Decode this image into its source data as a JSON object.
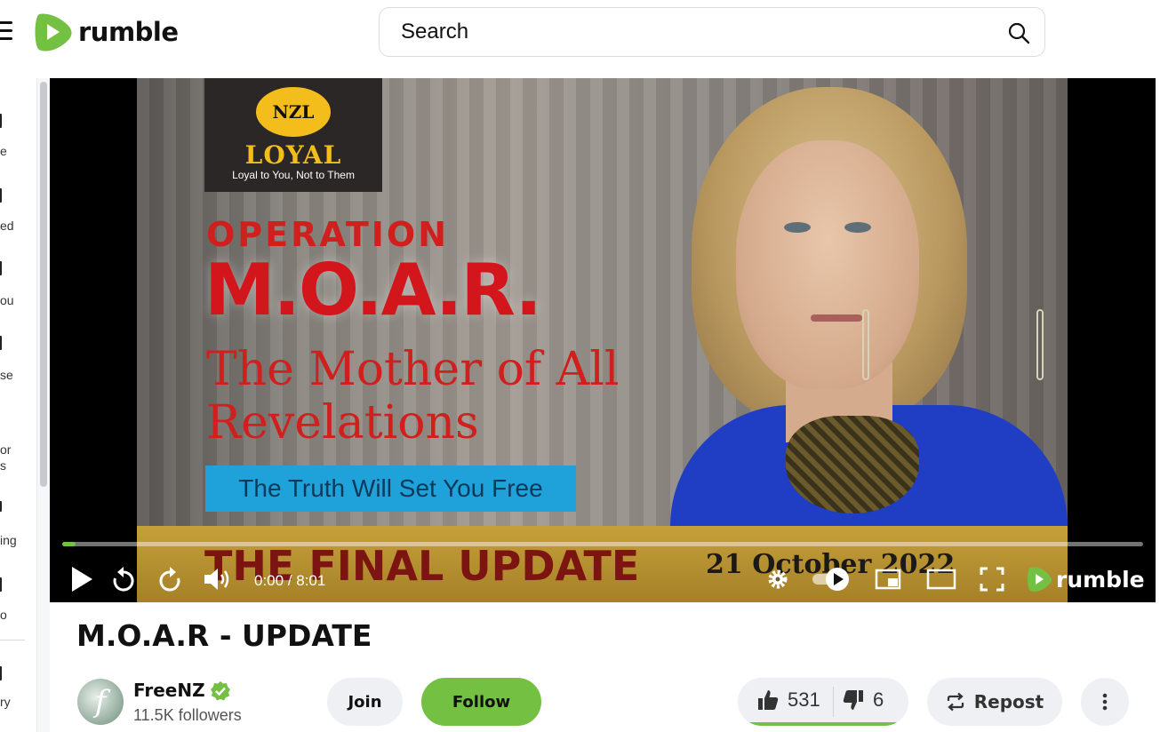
{
  "header": {
    "logo_text": "rumble",
    "search_placeholder": "Search",
    "brand_color": "#74c043"
  },
  "sidebar": {
    "items": [
      {
        "label": "e"
      },
      {
        "label": "ed"
      },
      {
        "label": "ou"
      },
      {
        "label": "se"
      },
      {
        "label": "or"
      },
      {
        "label": "s"
      },
      {
        "label": "ing"
      },
      {
        "label": "o"
      },
      {
        "label": "ry"
      }
    ]
  },
  "video": {
    "thumbnail": {
      "badge_oval": "NZL",
      "badge_title": "LOYAL",
      "badge_tagline": "Loyal to You, Not to Them",
      "line1": "OPERATION",
      "line2": "M.O.A.R.",
      "line3": "The Mother of All Revelations",
      "banner": "The Truth Will Set You Free",
      "bottom_title": "THE FINAL UPDATE",
      "bottom_date": "21 October 2022"
    },
    "progress_fraction": 0.012,
    "time_display": "0:00 / 8:01",
    "player_logo_text": "rumble",
    "title": "M.O.A.R - UPDATE"
  },
  "channel": {
    "name": "FreeNZ",
    "followers": "11.5K followers",
    "avatar_letter": "f",
    "verified": true
  },
  "actions": {
    "join_label": "Join",
    "follow_label": "Follow",
    "likes": "531",
    "dislikes": "6",
    "like_fraction": 0.988,
    "repost_label": "Repost"
  },
  "icons": {
    "menu": "hamburger-icon",
    "search": "search-icon",
    "play": "play-icon",
    "replay": "rewind-icon",
    "forward": "forward-icon",
    "volume": "volume-icon",
    "settings": "gear-icon",
    "autoplay": "autoplay-toggle-icon",
    "pip": "picture-in-picture-icon",
    "theater": "theater-mode-icon",
    "fullscreen": "fullscreen-icon",
    "like": "thumbs-up-icon",
    "dislike": "thumbs-down-icon",
    "repost": "repost-icon",
    "more": "more-vertical-icon"
  }
}
